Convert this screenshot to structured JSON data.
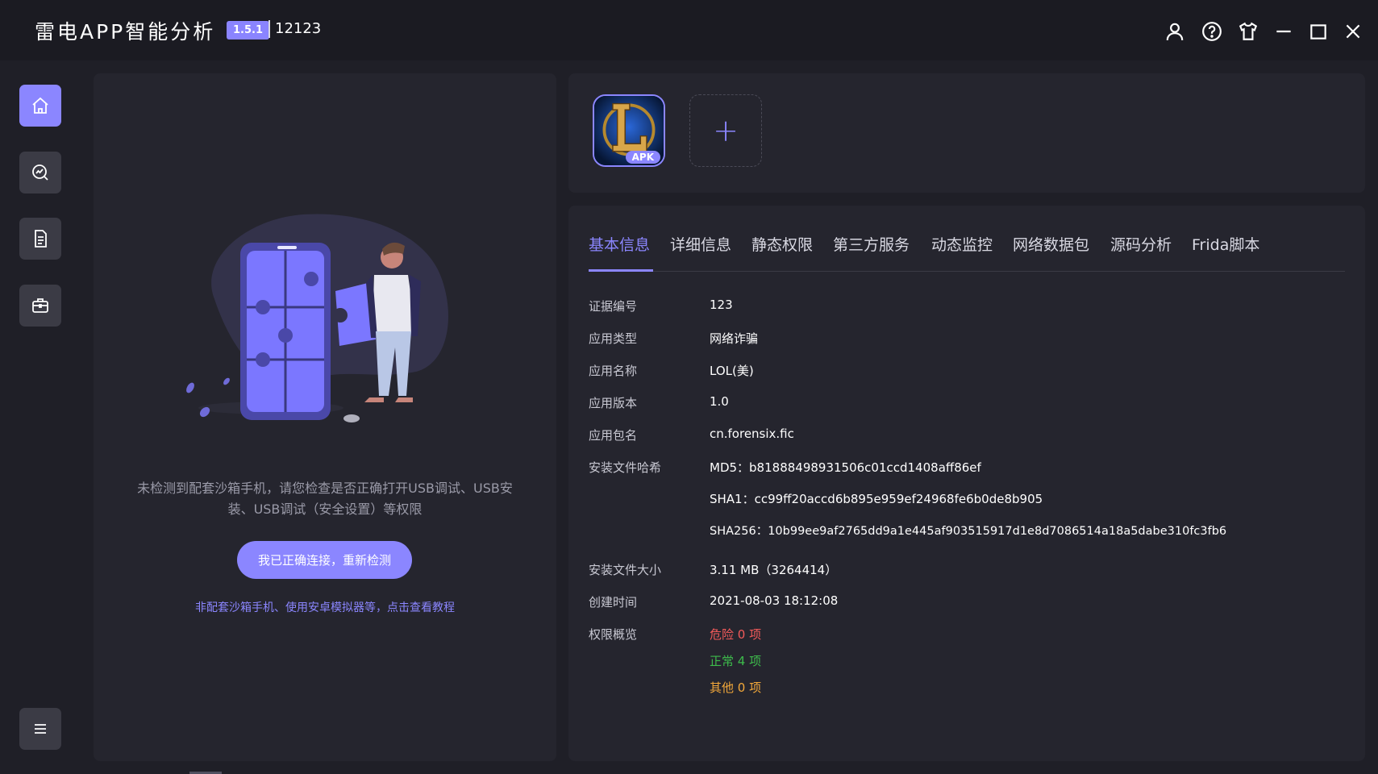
{
  "app": {
    "title": "雷电APP智能分析",
    "version": "1.5.1",
    "user_id": "12123"
  },
  "titlebar_icons": [
    "user-icon",
    "help-icon",
    "skin-icon",
    "minimize-icon",
    "maximize-icon",
    "close-icon"
  ],
  "sidebar": {
    "items": [
      {
        "icon": "home-icon",
        "active": true
      },
      {
        "icon": "analysis-icon",
        "active": false
      },
      {
        "icon": "report-icon",
        "active": false
      },
      {
        "icon": "toolbox-icon",
        "active": false
      }
    ],
    "menu_icon": "menu-icon"
  },
  "left_panel": {
    "notice": "未检测到配套沙箱手机，请您检查是否正确打开USB调试、USB安装、USB调试（安全设置）等权限",
    "recheck_button": "我已正确连接，重新检测",
    "tutorial_link": "非配套沙箱手机、使用安卓模拟器等，点击查看教程"
  },
  "apk_panel": {
    "apk_badge": "APK",
    "add_symbol": "+"
  },
  "tabs": [
    "基本信息",
    "详细信息",
    "静态权限",
    "第三方服务",
    "动态监控",
    "网络数据包",
    "源码分析",
    "Frida脚本"
  ],
  "active_tab": 0,
  "basic_info": {
    "evidence_no_label": "证据编号",
    "evidence_no": "123",
    "app_type_label": "应用类型",
    "app_type": "网络诈骗",
    "app_name_label": "应用名称",
    "app_name": "LOL(美)",
    "app_version_label": "应用版本",
    "app_version": "1.0",
    "package_label": "应用包名",
    "package": "cn.forensix.fic",
    "hash_label": "安装文件哈希",
    "md5": "MD5：b81888498931506c01ccd1408aff86ef",
    "sha1": "SHA1：cc99ff20accd6b895e959ef24968fe6b0de8b905",
    "sha256": "SHA256：10b99ee9af2765dd9a1e445af903515917d1e8d7086514a18a5dabe310fc3fb6",
    "size_label": "安装文件大小",
    "size": "3.11 MB（3264414）",
    "created_label": "创建时间",
    "created": "2021-08-03 18:12:08",
    "perm_label": "权限概览",
    "perm_danger": "危险 0 项",
    "perm_normal": "正常 4 项",
    "perm_other": "其他 0 项"
  },
  "colors": {
    "accent": "#8b86ff",
    "danger": "#f25a5a",
    "normal": "#3dbb4b",
    "other": "#f2a83a"
  }
}
